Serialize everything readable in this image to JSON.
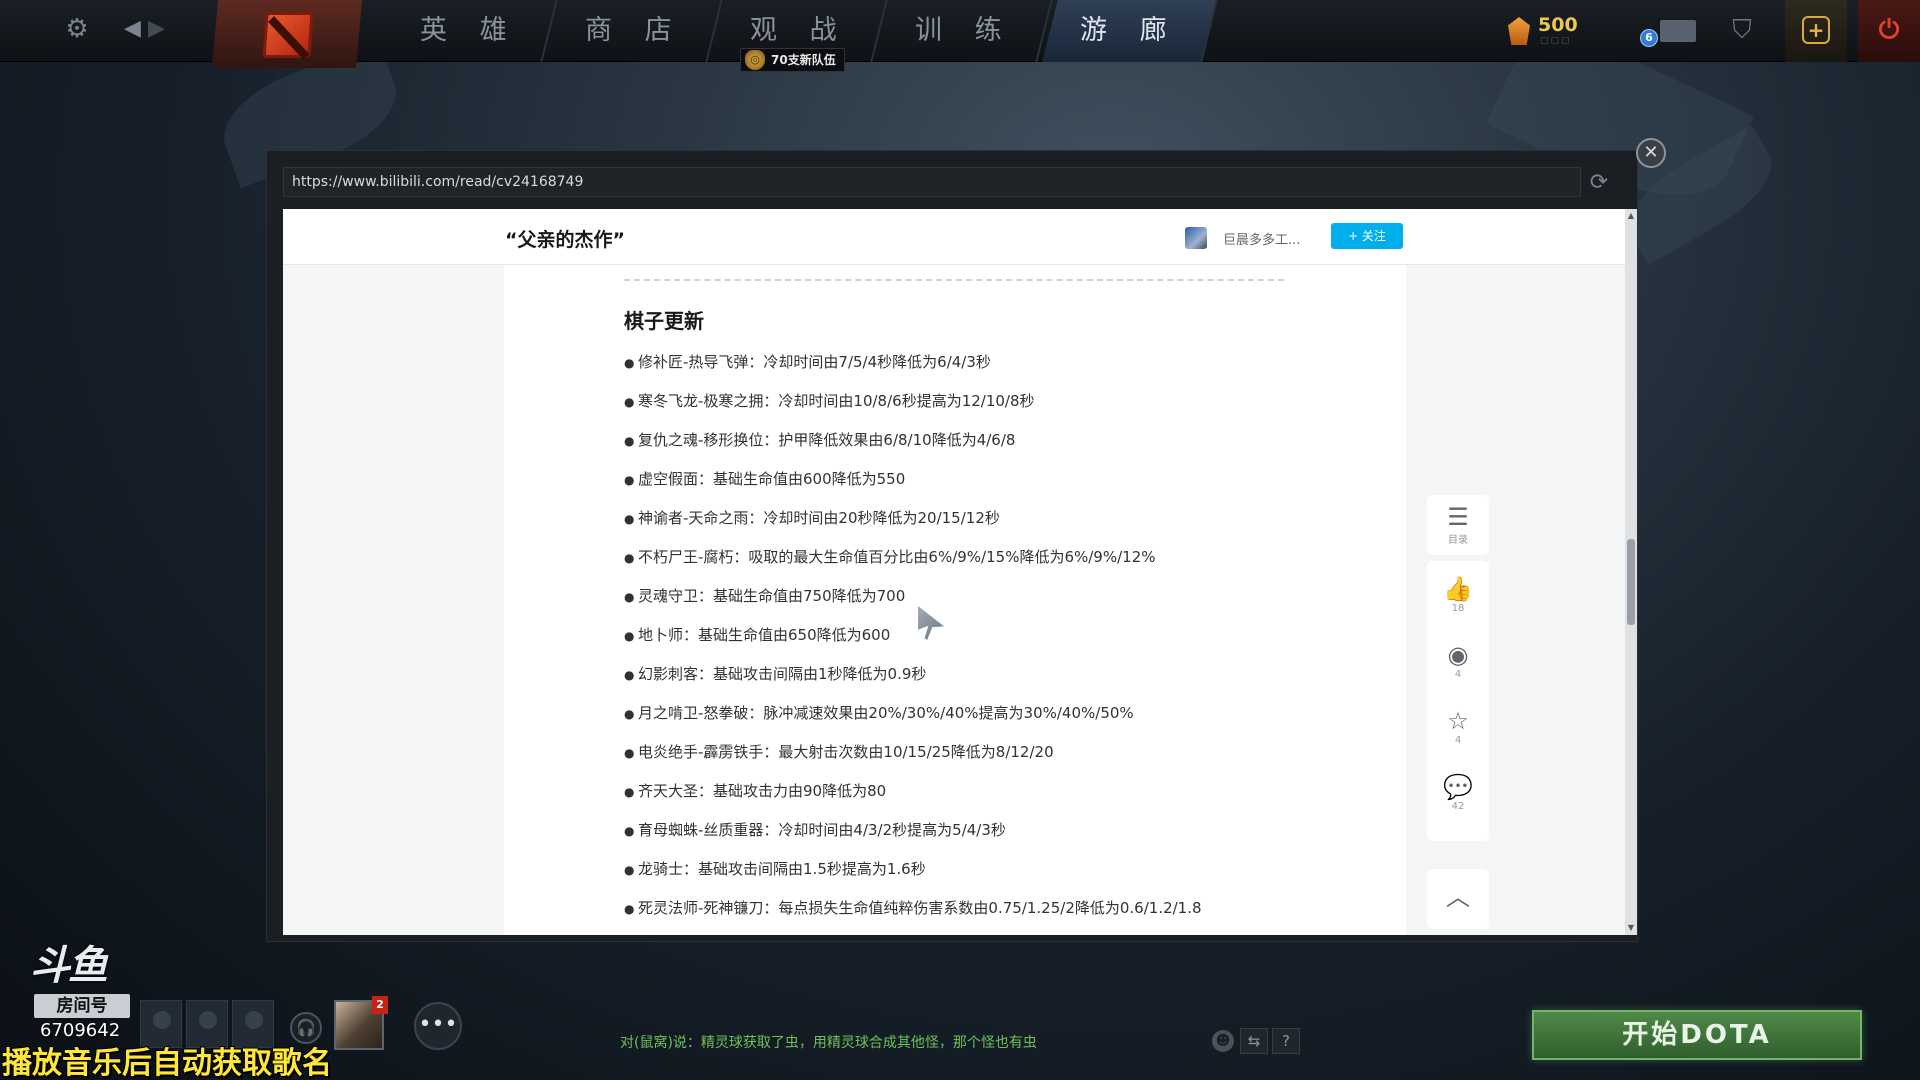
{
  "topbar": {
    "nav_tabs": [
      {
        "label": "英 雄"
      },
      {
        "label": "商 店"
      },
      {
        "label": "观 战"
      },
      {
        "label": "训 练"
      },
      {
        "label": "游 廊"
      }
    ],
    "active_tab": "游 廊",
    "team_badge": "70支新队伍",
    "shards": "500",
    "mail_count": "6"
  },
  "browser": {
    "url": "https://www.bilibili.com/read/cv24168749",
    "article_title": "“父亲的杰作”",
    "author_name": "巨晨多多工...",
    "follow_label": "+ 关注",
    "section_title": "棋子更新",
    "items": [
      "修补匠-热导飞弹：冷却时间由7/5/4秒降低为6/4/3秒",
      "寒冬飞龙-极寒之拥：冷却时间由10/8/6秒提高为12/10/8秒",
      "复仇之魂-移形换位：护甲降低效果由6/8/10降低为4/6/8",
      "虚空假面：基础生命值由600降低为550",
      "神谕者-天命之雨：冷却时间由20秒降低为20/15/12秒",
      "不朽尸王-腐朽：吸取的最大生命值百分比由6%/9%/15%降低为6%/9%/12%",
      "灵魂守卫：基础生命值由750降低为700",
      "地卜师：基础生命值由650降低为600",
      "幻影刺客：基础攻击间隔由1秒降低为0.9秒",
      "月之啃卫-怒拳破：脉冲减速效果由20%/30%/40%提高为30%/40%/50%",
      "电炎绝手-霹雳铁手：最大射击次数由10/15/25降低为8/12/20",
      "齐天大圣：基础攻击力由90降低为80",
      "育母蜘蛛-丝质重器：冷却时间由4/3/2秒提高为5/4/3秒",
      "龙骑士：基础攻击间隔由1.5秒提高为1.6秒",
      "死灵法师-死神镰刀：每点损失生命值纯粹伤害系数由0.75/1.25/2降低为0.6/1.2/1.8"
    ],
    "side": {
      "toc_label": "目录",
      "likes": "18",
      "coins": "4",
      "favorites": "4",
      "comments": "42"
    }
  },
  "bottom": {
    "platform_logo": "斗鱼",
    "room_label": "房间号",
    "room_number": "6709642",
    "notification_count": "2",
    "overlay_caption": "播放音乐后自动获取歌名",
    "chat_message": "对(鼠窝)说：精灵球获取了虫，用精灵球合成其他怪，那个怪也有虫",
    "help_label": "?",
    "play_button": "开始DOTA"
  },
  "colors": {
    "accent_follow": "#00aeec",
    "play_green": "#4f8a48",
    "chat_green": "#6ec05a",
    "caption_yellow": "#ffe63a",
    "shard_gold": "#f0c64e"
  }
}
